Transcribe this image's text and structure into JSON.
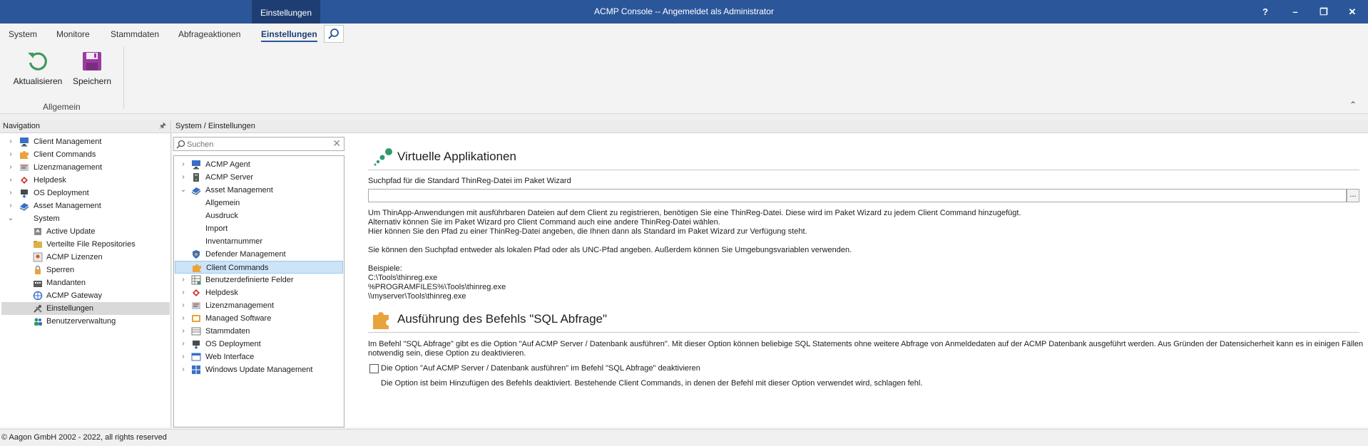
{
  "window": {
    "context_tab": "Einstellungen",
    "title": "ACMP Console -- Angemeldet als Administrator",
    "buttons": {
      "help": "?",
      "minimize": "–",
      "restore": "❐",
      "close": "✕"
    }
  },
  "menu": {
    "tabs": [
      "System",
      "Monitore",
      "Stammdaten",
      "Abfrageaktionen",
      "Einstellungen"
    ],
    "active_tab": "Einstellungen"
  },
  "ribbon": {
    "refresh_label": "Aktualisieren",
    "save_label": "Speichern",
    "group_label": "Allgemein",
    "collapse_glyph": "⌃"
  },
  "navigation": {
    "header": "Navigation",
    "pin_glyph": "🖈",
    "items": [
      {
        "label": "Client Management",
        "icon": "monitor-icon"
      },
      {
        "label": "Client Commands",
        "icon": "puzzle-icon"
      },
      {
        "label": "Lizenzmanagement",
        "icon": "license-icon"
      },
      {
        "label": "Helpdesk",
        "icon": "helpdesk-icon"
      },
      {
        "label": "OS Deployment",
        "icon": "os-deployment-icon"
      },
      {
        "label": "Asset Management",
        "icon": "asset-icon"
      },
      {
        "label": "System",
        "icon": "none"
      },
      {
        "label": "Active Update",
        "icon": "active-update-icon"
      },
      {
        "label": "Verteilte File Repositories",
        "icon": "repository-icon"
      },
      {
        "label": "ACMP Lizenzen",
        "icon": "acmp-license-icon"
      },
      {
        "label": "Sperren",
        "icon": "lock-icon"
      },
      {
        "label": "Mandanten",
        "icon": "tenant-icon"
      },
      {
        "label": "ACMP Gateway",
        "icon": "gateway-icon"
      },
      {
        "label": "Einstellungen",
        "icon": "tools-icon"
      },
      {
        "label": "Benutzerverwaltung",
        "icon": "users-icon"
      }
    ],
    "selected": "Einstellungen"
  },
  "main": {
    "breadcrumb": "System / Einstellungen",
    "search_placeholder": "Suchen",
    "tree": [
      {
        "label": "ACMP Agent",
        "icon": "monitor-icon"
      },
      {
        "label": "ACMP Server",
        "icon": "server-icon"
      },
      {
        "label": "Asset Management",
        "icon": "asset-icon"
      },
      {
        "label": "Allgemein",
        "icon": "none"
      },
      {
        "label": "Ausdruck",
        "icon": "none"
      },
      {
        "label": "Import",
        "icon": "none"
      },
      {
        "label": "Inventarnummer",
        "icon": "none"
      },
      {
        "label": "Defender Management",
        "icon": "shield-icon"
      },
      {
        "label": "Client Commands",
        "icon": "puzzle-icon"
      },
      {
        "label": "Benutzerdefinierte Felder",
        "icon": "custom-fields-icon"
      },
      {
        "label": "Helpdesk",
        "icon": "helpdesk-icon"
      },
      {
        "label": "Lizenzmanagement",
        "icon": "license-icon"
      },
      {
        "label": "Managed Software",
        "icon": "managed-software-icon"
      },
      {
        "label": "Stammdaten",
        "icon": "master-data-icon"
      },
      {
        "label": "OS Deployment",
        "icon": "os-deployment-icon"
      },
      {
        "label": "Web Interface",
        "icon": "web-interface-icon"
      },
      {
        "label": "Windows Update Management",
        "icon": "windows-update-icon"
      }
    ],
    "tree_selected": "Client Commands"
  },
  "content": {
    "section1": {
      "title": "Virtuelle Applikationen",
      "field_label": "Suchpfad für die Standard ThinReg-Datei im Paket Wizard",
      "field_value": "",
      "browse_label": "...",
      "desc1": "Um ThinApp-Anwendungen mit ausführbaren Dateien auf dem Client zu registrieren, benötigen Sie eine ThinReg-Datei. Diese wird im Paket Wizard zu jedem Client Command hinzugefügt.",
      "desc2": "Alternativ können Sie im Paket Wizard pro Client Command auch eine andere ThinReg-Datei wählen.",
      "desc3": "Hier können Sie den Pfad zu einer ThinReg-Datei angeben, die Ihnen dann als Standard im Paket Wizard zur Verfügung steht.",
      "desc4": "Sie können den Suchpfad entweder als lokalen Pfad oder als UNC-Pfad angeben. Außerdem können Sie Umgebungsvariablen verwenden.",
      "examples_label": "Beispiele:",
      "example1": "C:\\Tools\\thinreg.exe",
      "example2": "%PROGRAMFILES%\\Tools\\thinreg.exe",
      "example3": "\\\\myserver\\Tools\\thinreg.exe"
    },
    "section2": {
      "title": "Ausführung des Befehls \"SQL Abfrage\"",
      "desc1": "Im Befehl \"SQL Abfrage\" gibt es die Option \"Auf ACMP Server / Datenbank ausführen\". Mit dieser Option können beliebige SQL Statements ohne weitere Abfrage von Anmeldedaten auf der ACMP Datenbank ausgeführt werden. Aus Gründen der Datensicherheit kann es in einigen Fällen",
      "desc2": "notwendig sein, diese Option zu deaktivieren.",
      "checkbox_label": "Die Option \"Auf ACMP Server / Datenbank ausführen\" im Befehl \"SQL Abfrage\" deaktivieren",
      "checkbox_checked": false,
      "note": "Die Option ist beim Hinzufügen des Befehls deaktiviert. Bestehende Client Commands, in denen der Befehl mit dieser Option verwendet wird, schlagen fehl."
    }
  },
  "status": {
    "copyright": "© Aagon GmbH 2002 - 2022, all rights reserved"
  },
  "colors": {
    "titlebar": "#2b579a",
    "context_tab": "#1e3e73",
    "selection_nav": "#d9d9d9",
    "selection_tree": "#cce4f7"
  }
}
